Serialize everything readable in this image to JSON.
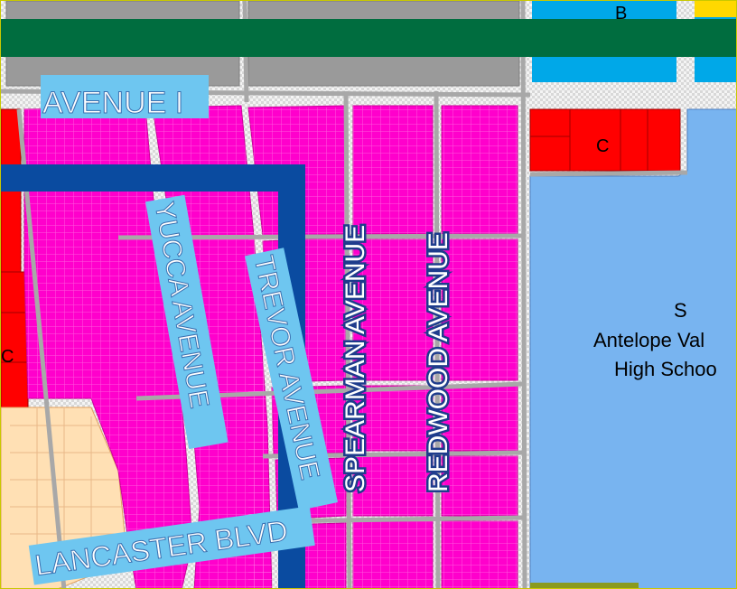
{
  "map": {
    "street_labels": {
      "avenue_i": "AVENUE I",
      "yucca": "YUCCA AVENUE",
      "trevor": "TREVOR AVENUE",
      "spearman": "SPEARMAN AVENUE",
      "redwood": "REDWOOD AVENUE",
      "lancaster": "LANCASTER BLVD"
    },
    "zone_labels": {
      "top_right": "B",
      "commercial_right": "C",
      "commercial_left": "C",
      "school_code": "S",
      "school_line1": "Antelope Val",
      "school_line2": "High Schoo"
    }
  },
  "colors": {
    "residential": "#ff00cc",
    "commercial": "#ff0000",
    "school": "#78b4f0",
    "public": "#00a8e8",
    "low_density": "#ffe0b4",
    "header_bar": "#006d3f",
    "route_line": "#0a4ba0",
    "street": "#c8c8c8",
    "label_bg": "#6ec6f0"
  }
}
